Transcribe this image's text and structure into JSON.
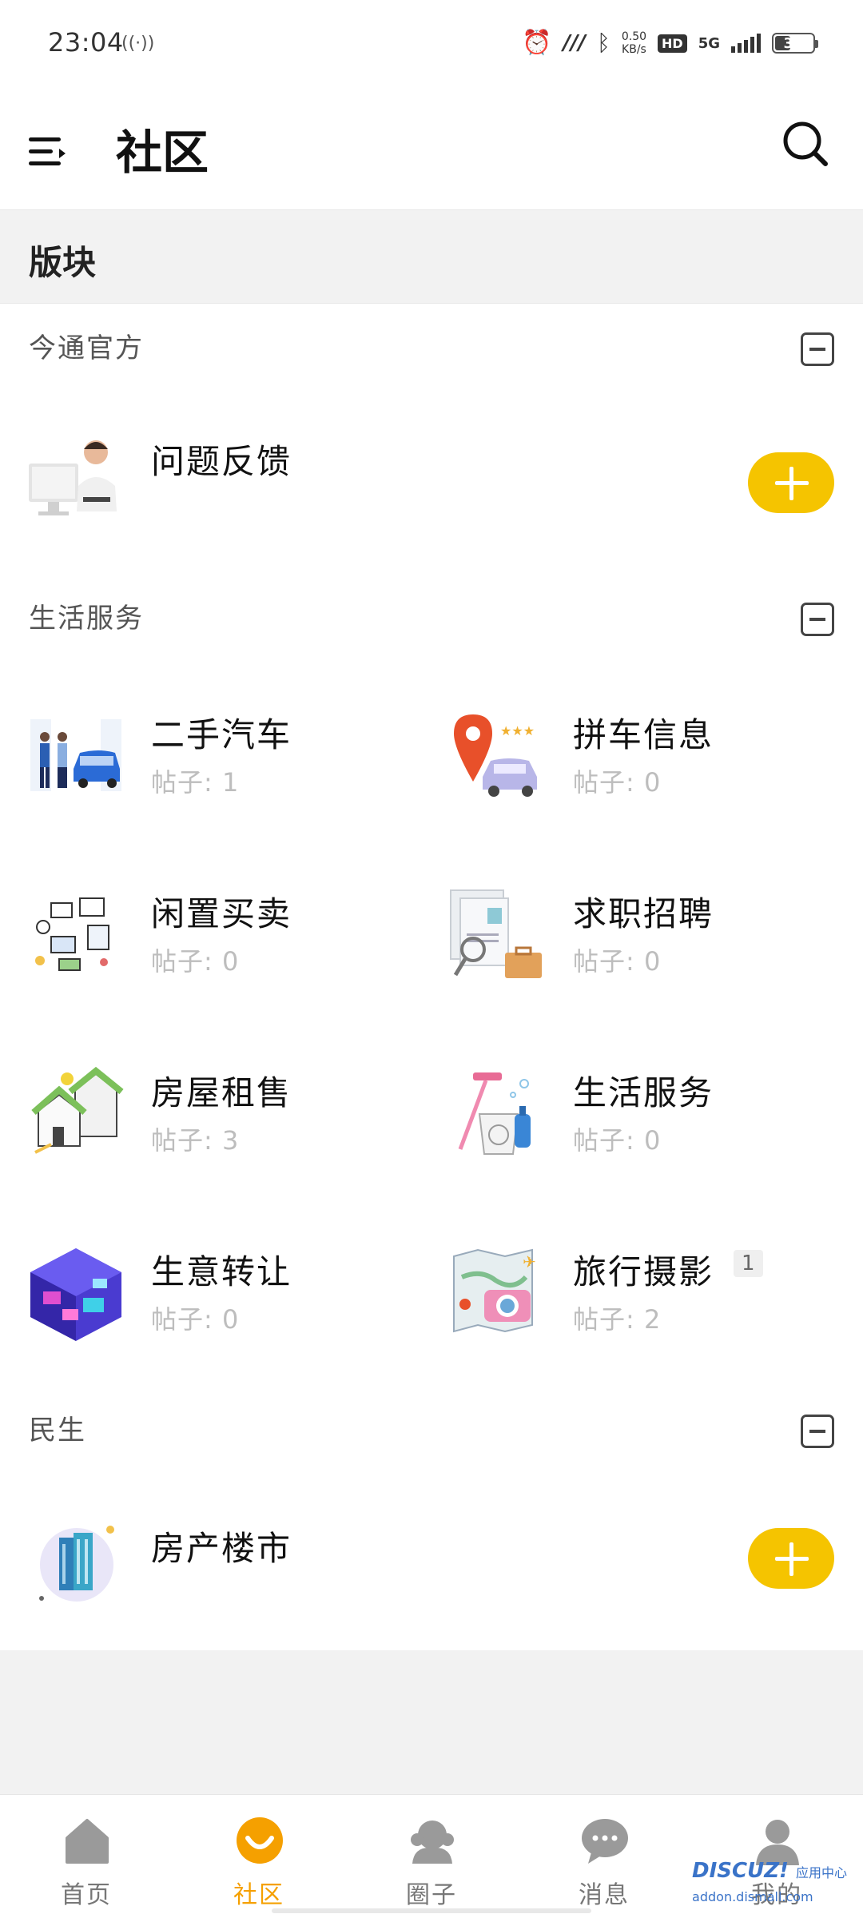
{
  "status_bar": {
    "time": "23:04",
    "hotspot": "((·))",
    "net_speed_value": "0.50",
    "net_speed_unit": "KB/s",
    "hd": "HD",
    "network": "5G",
    "battery": "38"
  },
  "header": {
    "title": "社区"
  },
  "section": {
    "label": "版块"
  },
  "groups": [
    {
      "title": "今通官方",
      "forums": [
        {
          "name": "问题反馈"
        }
      ]
    },
    {
      "title": "生活服务",
      "forums": [
        {
          "name": "二手汽车",
          "count": "帖子: 1"
        },
        {
          "name": "拼车信息",
          "count": "帖子: 0"
        },
        {
          "name": "闲置买卖",
          "count": "帖子: 0"
        },
        {
          "name": "求职招聘",
          "count": "帖子: 0"
        },
        {
          "name": "房屋租售",
          "count": "帖子: 3"
        },
        {
          "name": "生活服务",
          "count": "帖子: 0"
        },
        {
          "name": "生意转让",
          "count": "帖子: 0"
        },
        {
          "name": "旅行摄影",
          "count": "帖子: 2",
          "badge": "1"
        }
      ]
    },
    {
      "title": "民生",
      "forums": [
        {
          "name": "房产楼市"
        }
      ]
    }
  ],
  "tabs": [
    {
      "label": "首页",
      "icon": "home-icon"
    },
    {
      "label": "社区",
      "icon": "community-icon"
    },
    {
      "label": "圈子",
      "icon": "circle-icon"
    },
    {
      "label": "消息",
      "icon": "message-icon"
    },
    {
      "label": "我的",
      "icon": "profile-icon"
    }
  ],
  "active_tab": "社区",
  "watermark": {
    "brand": "DISCUZ!",
    "sub": "应用中心",
    "url": "addon.dismall.com"
  },
  "colors": {
    "accent": "#f5c400",
    "active_tab": "#f5a000",
    "muted": "#bdbdbd"
  }
}
